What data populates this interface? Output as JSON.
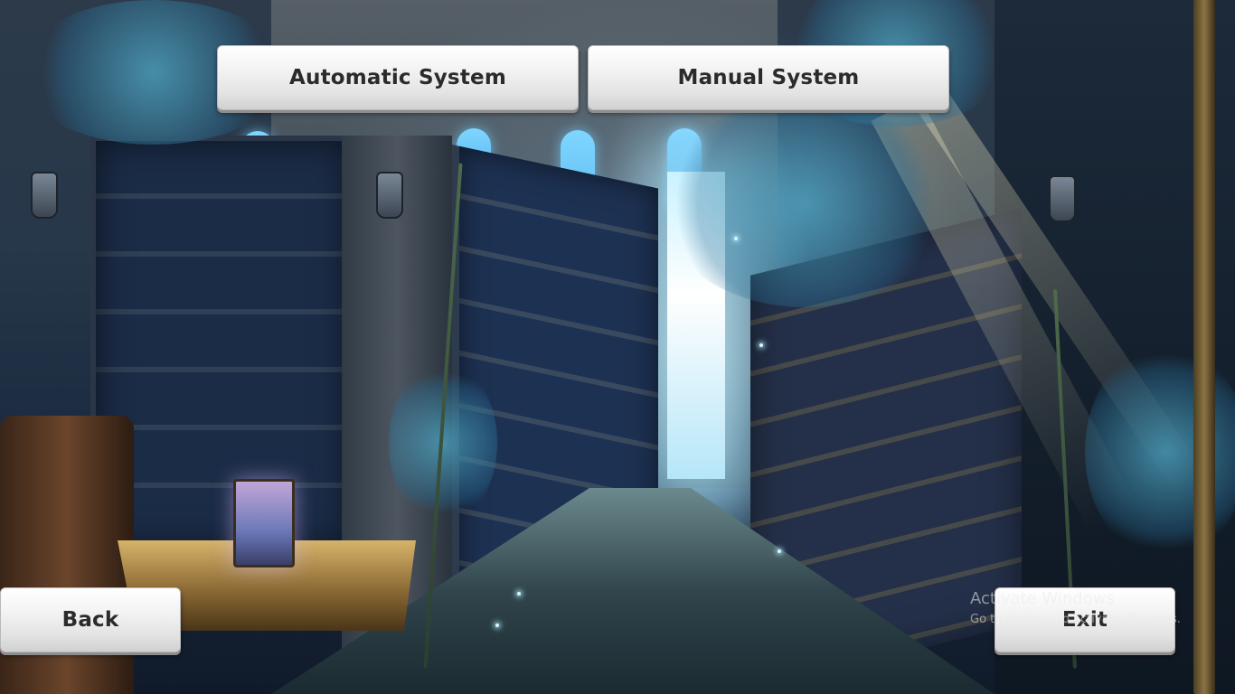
{
  "buttons": {
    "automatic_label": "Automatic System",
    "manual_label": "Manual System",
    "back_label": "Back",
    "exit_label": "Exit"
  },
  "watermark": {
    "title": "Activate Windows",
    "subtitle": "Go to Settings to activate Windows."
  },
  "colors": {
    "button_face": "#f0f0f0",
    "button_text": "#2b2b2b",
    "scene_dark": "#0f1c33",
    "scene_light": "#c9f2ff"
  }
}
